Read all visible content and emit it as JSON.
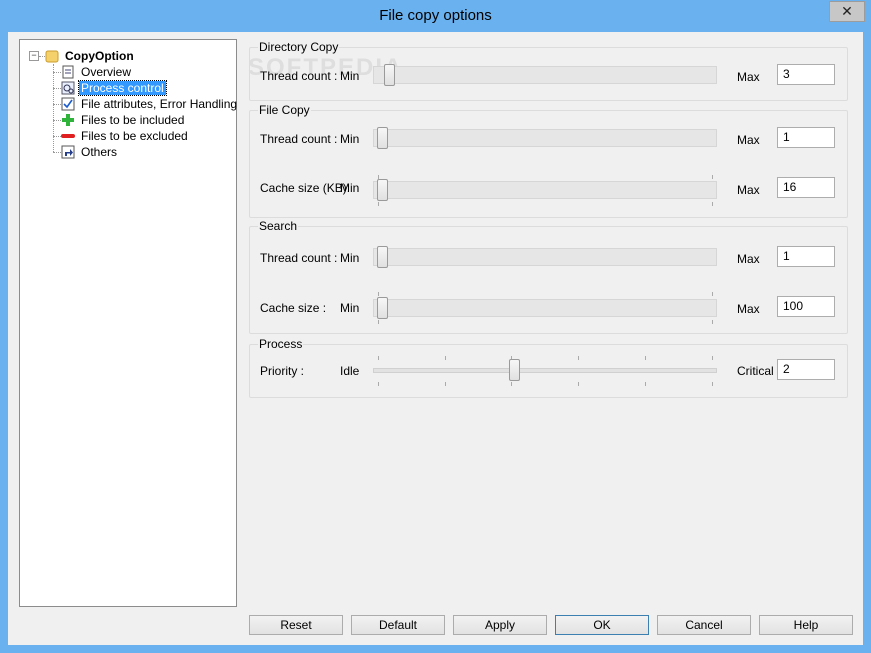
{
  "window": {
    "title": "File copy options",
    "close_glyph": "✕"
  },
  "watermark": "SOFTPEDIA",
  "tree": {
    "root": {
      "label": "CopyOption",
      "expander": "−"
    },
    "items": [
      {
        "label": "Overview",
        "icon": "document-icon",
        "selected": false
      },
      {
        "label": "Process control",
        "icon": "gears-icon",
        "selected": true
      },
      {
        "label": "File attributes, Error Handling",
        "icon": "checklist-icon",
        "selected": false
      },
      {
        "label": "Files to be included",
        "icon": "green-plus-icon",
        "selected": false
      },
      {
        "label": "Files to be excluded",
        "icon": "red-minus-icon",
        "selected": false
      },
      {
        "label": "Others",
        "icon": "shortcut-icon",
        "selected": false
      }
    ]
  },
  "groups": {
    "directory_copy": {
      "title": "Directory Copy",
      "thread": {
        "label": "Thread count :",
        "min": "Min",
        "max": "Max",
        "value": "3",
        "slider_fraction": 0.02
      }
    },
    "file_copy": {
      "title": "File Copy",
      "thread": {
        "label": "Thread count :",
        "min": "Min",
        "max": "Max",
        "value": "1",
        "slider_fraction": 0.0
      },
      "cache": {
        "label": "Cache size (KB):",
        "min": "Min",
        "max": "Max",
        "value": "16",
        "slider_fraction": 0.0
      }
    },
    "search": {
      "title": "Search",
      "thread": {
        "label": "Thread count :",
        "min": "Min",
        "max": "Max",
        "value": "1",
        "slider_fraction": 0.0
      },
      "cache": {
        "label": "Cache size :",
        "min": "Min",
        "max": "Max",
        "value": "100",
        "slider_fraction": 0.0
      }
    },
    "process": {
      "title": "Process",
      "priority": {
        "label": "Priority :",
        "min": "Idle",
        "max": "Critical",
        "value": "2",
        "slider_fraction": 0.4
      }
    }
  },
  "buttons": {
    "reset": "Reset",
    "default": "Default",
    "apply": "Apply",
    "ok": "OK",
    "cancel": "Cancel",
    "help": "Help"
  },
  "colors": {
    "titlebar": "#6ab1ef",
    "selection": "#3399ff"
  }
}
